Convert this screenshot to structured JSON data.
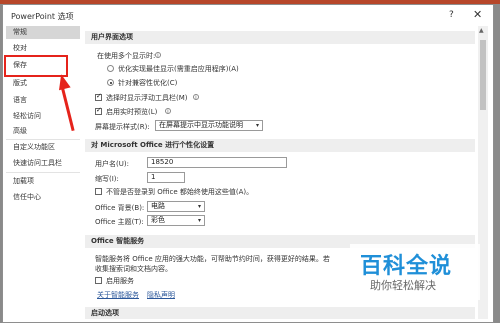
{
  "window": {
    "title": "PowerPoint 选项",
    "help_glyph": "?",
    "close_glyph": "✕"
  },
  "sidebar": {
    "items": [
      {
        "label": "常规",
        "selected": true
      },
      {
        "label": "校对"
      },
      {
        "label": "保存"
      },
      {
        "label": "版式"
      },
      {
        "label": "语言"
      },
      {
        "label": "轻松访问"
      },
      {
        "label": "高级"
      },
      {
        "label": "自定义功能区"
      },
      {
        "label": "快速访问工具栏"
      },
      {
        "label": "加载项"
      },
      {
        "label": "信任中心"
      }
    ]
  },
  "annotation": {
    "highlight_color": "#e5231b"
  },
  "sections": {
    "ui_options": {
      "header": "用户界面选项",
      "multi_display_label": "在使用多个显示时:",
      "radio_best": "优化实现最佳显示(需重启应用程序)(A)",
      "radio_compat": "针对兼容性优化(C)",
      "mini_toolbar": "选择时显示浮动工具栏(M)",
      "live_preview": "启用实时预览(L)",
      "tooltip_style_label": "屏幕提示样式(R):",
      "tooltip_style_value": "在屏幕提示中显示功能说明"
    },
    "personalize": {
      "header": "对 Microsoft Office 进行个性化设置",
      "username_label": "用户名(U):",
      "username_value": "18520",
      "initials_label": "缩写(I):",
      "initials_value": "1",
      "always_use_label": "不管是否登录到 Office 都始终使用这些值(A)。",
      "background_label": "Office 背景(B):",
      "background_value": "电路",
      "theme_label": "Office 主题(T):",
      "theme_value": "彩色"
    },
    "intelligent": {
      "header": "Office 智能服务",
      "description_line1": "智能服务将 Office 应用的强大功能，可帮助节约时间，获得更好的结果。若",
      "description_line2": "收集搜索词和文档内容。",
      "enable_label": "启用服务",
      "link_about": "关于智能服务",
      "link_privacy": "隐私声明"
    },
    "startup": {
      "header": "启动选项"
    }
  },
  "watermark": {
    "main": "百科全说",
    "sub": "助你轻松解决",
    "color": "#1f8fd8"
  }
}
